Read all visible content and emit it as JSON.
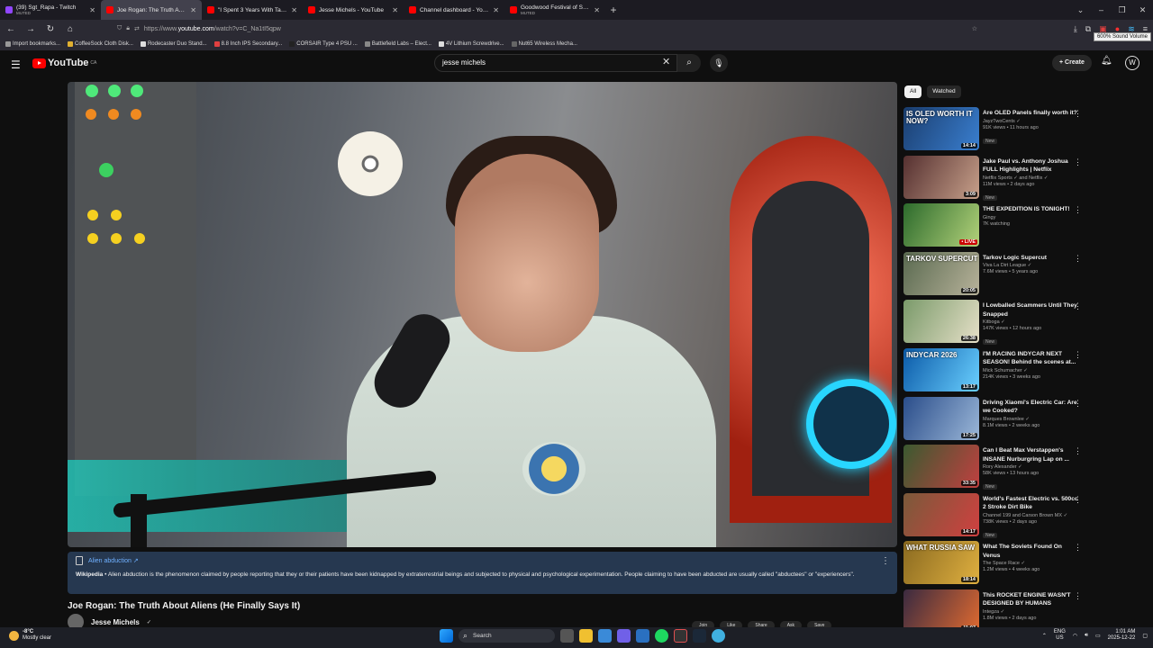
{
  "tabs": [
    {
      "title": "(39) Sgt_Rapa - Twitch",
      "sub": "MUTED",
      "color": "#9146ff"
    },
    {
      "title": "Joe Rogan: The Truth About Ali",
      "sub": "",
      "color": "#ff0000"
    },
    {
      "title": "\"I Spent 3 Years With Tall Whit",
      "sub": "",
      "color": "#ff0000"
    },
    {
      "title": "Jesse Michels - YouTube",
      "sub": "",
      "color": "#ff0000"
    },
    {
      "title": "Channel dashboard - YouTube S",
      "sub": "",
      "color": "#ff0000"
    },
    {
      "title": "Goodwood Festival of Speed –",
      "sub": "MUTED",
      "color": "#ff0000"
    }
  ],
  "browser": {
    "url_prefix": "https://www.",
    "url_domain": "youtube.com",
    "url_path": "/watch?v=C_Na1tI5qpw",
    "tooltip": "600% Sound Volume"
  },
  "bookmarks": [
    {
      "label": "Import bookmarks...",
      "color": "#999999"
    },
    {
      "label": "CoffeeSock Cloth Disk...",
      "color": "#e0b030"
    },
    {
      "label": "Rodecaster Duo Stand...",
      "color": "#dddddd"
    },
    {
      "label": "8.8 Inch IPS Secondary...",
      "color": "#e04040"
    },
    {
      "label": "CORSAIR Type 4 PSU ...",
      "color": "#222222"
    },
    {
      "label": "Battlefield Labs – Elect...",
      "color": "#888888"
    },
    {
      "label": "4V Lithium Screwdrive...",
      "color": "#dddddd"
    },
    {
      "label": "Nut65 Wireless Mecha...",
      "color": "#666666"
    }
  ],
  "youtube": {
    "logo": "YouTube",
    "region": "CA",
    "search_query": "jesse michels",
    "create_label": "Create"
  },
  "wiki": {
    "topic": "Alien abduction ↗",
    "source": "Wikipedia",
    "text": " • Alien abduction is the phenomenon claimed by people reporting that they or their patients have been kidnapped by extraterrestrial beings and subjected to physical and psychological experimentation. People claiming to have been abducted are usually called \"abductees\" or \"experiencers\"."
  },
  "video": {
    "title": "Joe Rogan: The Truth About Aliens (He Finally Says It)",
    "channel": "Jesse Michels",
    "actions": [
      "Join",
      "Like",
      "Share",
      "Ask",
      "Save"
    ]
  },
  "chips": [
    "All",
    "Watched"
  ],
  "recommendations": [
    {
      "title": "Are OLED Panels finally worth it?",
      "channel": "JayzTwoCents ✓",
      "meta": "91K views • 11 hours ago",
      "badge": "New",
      "duration": "14:14",
      "thumb_text": "IS OLED WORTH IT NOW?",
      "bg": "linear-gradient(120deg,#1a3d6e,#3a7fd0)",
      "live": false
    },
    {
      "title": "Jake Paul vs. Anthony Joshua FULL Highlights | Netflix",
      "channel": "Netflix Sports ✓ and Netflix ✓",
      "meta": "11M views • 2 days ago",
      "badge": "New",
      "duration": "3:09",
      "thumb_text": "",
      "bg": "linear-gradient(120deg,#553030,#c7a08a)",
      "live": false
    },
    {
      "title": "THE EXPEDITION IS TONIGHT!",
      "channel": "Gingy",
      "meta": "7K watching",
      "badge": "",
      "duration": "• LIVE",
      "thumb_text": "",
      "bg": "linear-gradient(120deg,#2c6a2c,#b3d27a)",
      "live": true
    },
    {
      "title": "Tarkov Logic Supercut",
      "channel": "Viva La Dirt League ✓",
      "meta": "7.6M views • 5 years ago",
      "badge": "",
      "duration": "20:05",
      "thumb_text": "TARKOV SUPERCUT",
      "bg": "linear-gradient(120deg,#5a6a50,#b7b29a)",
      "live": false
    },
    {
      "title": "I Lowballed Scammers Until They Snapped",
      "channel": "Kitboga ✓",
      "meta": "147K views • 12 hours ago",
      "badge": "New",
      "duration": "26:38",
      "thumb_text": "",
      "bg": "linear-gradient(120deg,#7a9a6a,#e6e0c8)",
      "live": false
    },
    {
      "title": "I'M RACING INDYCAR NEXT SEASON! Behind the scenes at...",
      "channel": "Mick Schumacher ✓",
      "meta": "214K views • 3 weeks ago",
      "badge": "",
      "duration": "13:17",
      "thumb_text": "INDYCAR 2026",
      "bg": "linear-gradient(120deg,#0b5aa8,#6ad0ff)",
      "live": false
    },
    {
      "title": "Driving Xiaomi's Electric Car: Are we Cooked?",
      "channel": "Marques Brownlee ✓",
      "meta": "8.1M views • 2 weeks ago",
      "badge": "",
      "duration": "17:25",
      "thumb_text": "",
      "bg": "linear-gradient(120deg,#2a4d8a,#9bb7d8)",
      "live": false
    },
    {
      "title": "Can I Beat Max Verstappen's INSANE Nurburgring Lap on ...",
      "channel": "Rory Alexander ✓",
      "meta": "58K views • 13 hours ago",
      "badge": "New",
      "duration": "33:35",
      "thumb_text": "",
      "bg": "linear-gradient(120deg,#3b5a30,#c04040)",
      "live": false
    },
    {
      "title": "World's Fastest Electric vs. 500cc 2 Stroke Dirt Bike",
      "channel": "Channel 199 and Carson Brown MX ✓",
      "meta": "738K views • 2 days ago",
      "badge": "New",
      "duration": "14:17",
      "thumb_text": "",
      "bg": "linear-gradient(120deg,#7a5a3a,#d04040)",
      "live": false
    },
    {
      "title": "What The Soviets Found On Venus",
      "channel": "The Space Race ✓",
      "meta": "1.2M views • 4 weeks ago",
      "badge": "",
      "duration": "18:14",
      "thumb_text": "WHAT RUSSIA SAW",
      "bg": "linear-gradient(120deg,#8a6a20,#e0b040)",
      "live": false
    },
    {
      "title": "This ROCKET ENGINE WASN'T DESIGNED BY HUMANS",
      "channel": "Integza ✓",
      "meta": "1.8M views • 2 days ago",
      "badge": "New",
      "duration": "11:07",
      "thumb_text": "",
      "bg": "linear-gradient(120deg,#3a2a40,#e06a30)",
      "live": false
    }
  ],
  "taskbar": {
    "temp": "-8°C",
    "weather": "Mostly clear",
    "search": "Search",
    "lang1": "ENG",
    "lang2": "US",
    "time": "1:01 AM",
    "date": "2025-12-22"
  }
}
